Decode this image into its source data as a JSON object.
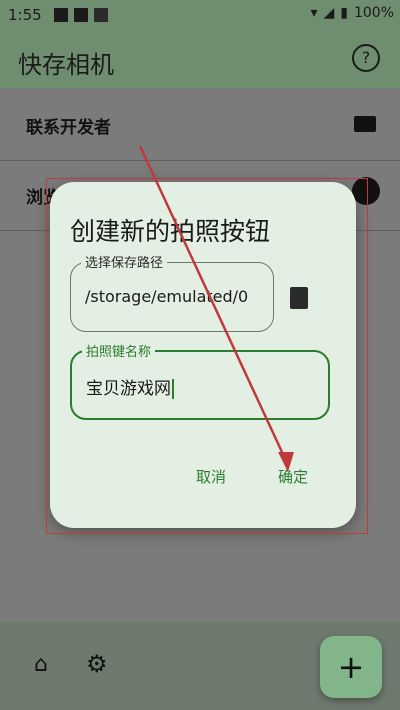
{
  "status_bar": {
    "time": "1:55",
    "battery": "100%"
  },
  "app_bar": {
    "title": "快存相机"
  },
  "list": {
    "items": [
      {
        "label": "联系开发者"
      },
      {
        "label": "浏览"
      }
    ]
  },
  "dialog": {
    "title": "创建新的拍照按钮",
    "path_field": {
      "label": "选择保存路径",
      "value": "/storage/emulated/0"
    },
    "name_field": {
      "label": "拍照键名称",
      "value": "宝贝游戏网"
    },
    "cancel_label": "取消",
    "ok_label": "确定"
  },
  "fab": {
    "label": "+"
  },
  "colors": {
    "accent": "#2c7b30",
    "appbar": "#6f8e6f",
    "dialog_bg": "#e3efe2",
    "annotation": "#c0393b"
  },
  "icons": [
    "help-icon",
    "mail-icon",
    "github-icon",
    "file-icon",
    "home-icon",
    "settings-icon",
    "add-icon"
  ]
}
